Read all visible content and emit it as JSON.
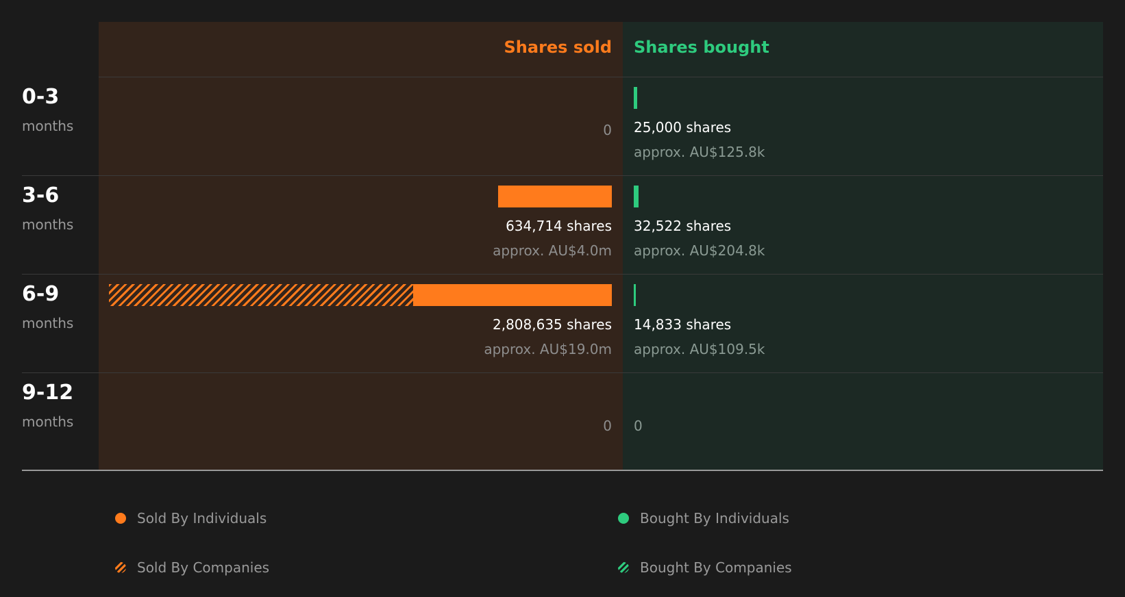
{
  "headers": {
    "sold": "Shares sold",
    "bought": "Shares bought"
  },
  "rows": [
    {
      "period": "0-3",
      "unit": "months",
      "sold": {
        "display": "0",
        "individuals": 0,
        "companies": 0
      },
      "bought": {
        "shares": "25,000 shares",
        "approx": "approx. AU$125.8k",
        "individuals": 25000,
        "companies": 0
      }
    },
    {
      "period": "3-6",
      "unit": "months",
      "sold": {
        "shares": "634,714 shares",
        "approx": "approx. AU$4.0m",
        "individuals": 634714,
        "companies": 0
      },
      "bought": {
        "shares": "32,522 shares",
        "approx": "approx. AU$204.8k",
        "individuals": 32522,
        "companies": 0
      }
    },
    {
      "period": "6-9",
      "unit": "months",
      "sold": {
        "shares": "2,808,635 shares",
        "approx": "approx. AU$19.0m",
        "individuals": 1110000,
        "companies": 1698635
      },
      "bought": {
        "shares": "14,833 shares",
        "approx": "approx. AU$109.5k",
        "individuals": 14833,
        "companies": 0
      }
    },
    {
      "period": "9-12",
      "unit": "months",
      "sold": {
        "display": "0",
        "individuals": 0,
        "companies": 0
      },
      "bought": {
        "display": "0",
        "individuals": 0,
        "companies": 0
      }
    }
  ],
  "legend": {
    "sold_individuals": "Sold By Individuals",
    "sold_companies": "Sold By Companies",
    "bought_individuals": "Bought By Individuals",
    "bought_companies": "Bought By Companies"
  },
  "colors": {
    "sold": "#ff7b1c",
    "bought": "#2ecb7e"
  },
  "chart_data": {
    "type": "bar",
    "title": "",
    "categories": [
      "0-3 months",
      "3-6 months",
      "6-9 months",
      "9-12 months"
    ],
    "series": [
      {
        "name": "Sold By Individuals",
        "values": [
          0,
          634714,
          1110000,
          0
        ]
      },
      {
        "name": "Sold By Companies",
        "values": [
          0,
          0,
          1698635,
          0
        ]
      },
      {
        "name": "Bought By Individuals",
        "values": [
          25000,
          32522,
          14833,
          0
        ]
      },
      {
        "name": "Bought By Companies",
        "values": [
          0,
          0,
          0,
          0
        ]
      }
    ],
    "sold_totals": [
      0,
      634714,
      2808635,
      0
    ],
    "bought_totals": [
      25000,
      32522,
      14833,
      0
    ],
    "sold_value_approx": [
      "0",
      "AU$4.0m",
      "AU$19.0m",
      "0"
    ],
    "bought_value_approx": [
      "AU$125.8k",
      "AU$204.8k",
      "AU$109.5k",
      "0"
    ],
    "legend_position": "bottom"
  }
}
